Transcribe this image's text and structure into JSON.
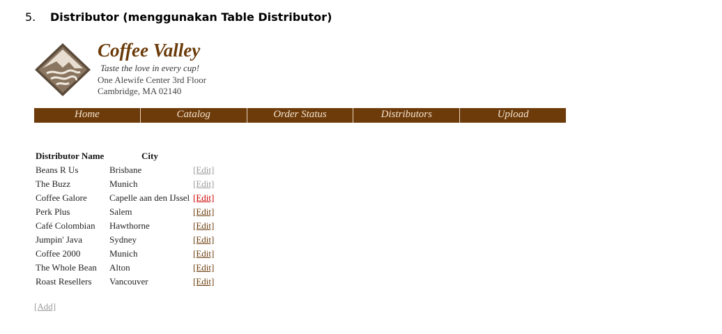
{
  "heading": {
    "number": "5.",
    "text": "Distributor (menggunakan Table Distributor)"
  },
  "brand": {
    "title": "Coffee Valley",
    "tagline": "Taste the love in every cup!",
    "address_line1": "One Alewife Center 3rd Floor",
    "address_line2": "Cambridge,  MA 02140"
  },
  "nav": [
    "Home",
    "Catalog",
    "Order Status",
    "Distributors",
    "Upload"
  ],
  "table": {
    "headers": {
      "name": "Distributor Name",
      "city": "City"
    },
    "edit_label": "[Edit]",
    "rows": [
      {
        "name": "Beans R Us",
        "city": "Brisbane"
      },
      {
        "name": "The Buzz",
        "city": "Munich"
      },
      {
        "name": "Coffee Galore",
        "city": "Capelle aan den IJssel"
      },
      {
        "name": "Perk Plus",
        "city": "Salem"
      },
      {
        "name": "Café Colombian",
        "city": "Hawthorne"
      },
      {
        "name": "Jumpin' Java",
        "city": "Sydney"
      },
      {
        "name": "Coffee 2000",
        "city": "Munich"
      },
      {
        "name": "The Whole Bean",
        "city": "Alton"
      },
      {
        "name": "Roast Resellers",
        "city": "Vancouver"
      }
    ]
  },
  "add_label": "[Add]",
  "colors": {
    "brand_brown": "#6d3a0a",
    "nav_text": "#f3e4cf",
    "link_active": "#cc0000",
    "link_muted": "#999999"
  }
}
